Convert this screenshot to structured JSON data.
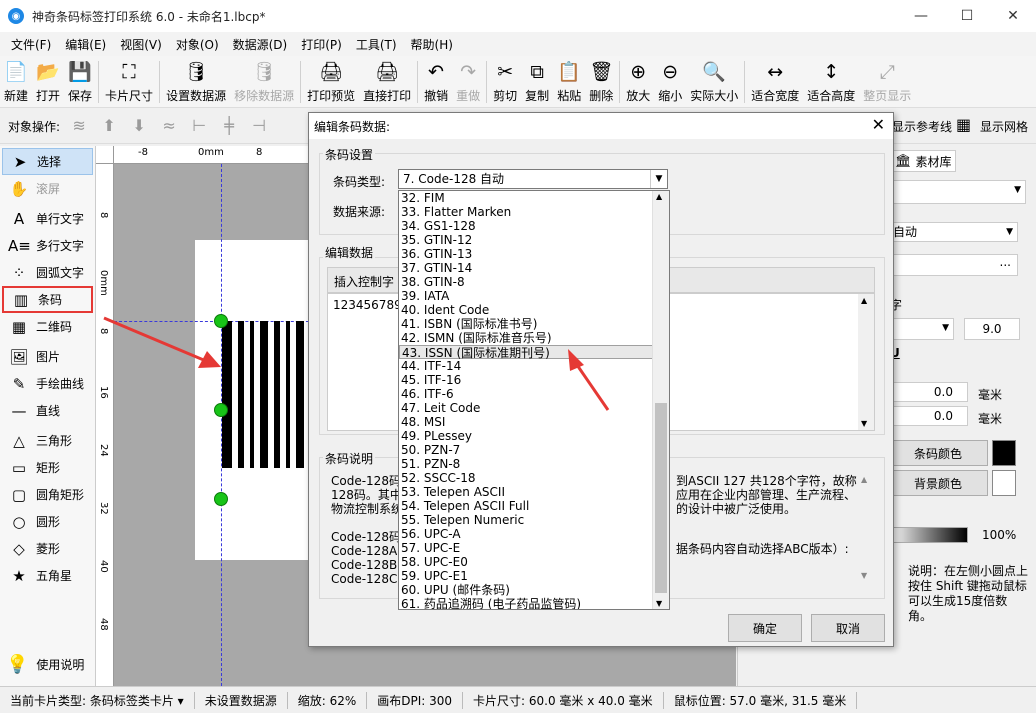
{
  "window": {
    "title": "神奇条码标签打印系统 6.0 - 未命名1.lbcp*",
    "min": "—",
    "max": "☐",
    "close": "✕"
  },
  "menu": [
    "文件(F)",
    "编辑(E)",
    "视图(V)",
    "对象(O)",
    "数据源(D)",
    "打印(P)",
    "工具(T)",
    "帮助(H)"
  ],
  "toolbar": [
    {
      "label": "新建",
      "icon": "📄",
      "icon_name": "new-file-icon",
      "enabled": true
    },
    {
      "label": "打开",
      "icon": "📂",
      "icon_name": "open-icon",
      "enabled": true
    },
    {
      "label": "保存",
      "icon": "💾",
      "icon_name": "save-icon",
      "enabled": true
    },
    {
      "label": "卡片尺寸",
      "icon": "⛶",
      "icon_name": "card-size-icon",
      "enabled": true
    },
    {
      "label": "设置数据源",
      "icon": "🛢",
      "icon_name": "database-icon",
      "enabled": true
    },
    {
      "label": "移除数据源",
      "icon": "🛢",
      "icon_name": "remove-database-icon",
      "enabled": false
    },
    {
      "label": "打印预览",
      "icon": "🖨",
      "icon_name": "print-preview-icon",
      "enabled": true
    },
    {
      "label": "直接打印",
      "icon": "🖨",
      "icon_name": "print-icon",
      "enabled": true
    },
    {
      "label": "撤销",
      "icon": "↶",
      "icon_name": "undo-icon",
      "enabled": true
    },
    {
      "label": "重做",
      "icon": "↷",
      "icon_name": "redo-icon",
      "enabled": false
    },
    {
      "label": "剪切",
      "icon": "✂",
      "icon_name": "cut-icon",
      "enabled": true
    },
    {
      "label": "复制",
      "icon": "⧉",
      "icon_name": "copy-icon",
      "enabled": true
    },
    {
      "label": "粘贴",
      "icon": "📋",
      "icon_name": "paste-icon",
      "enabled": true
    },
    {
      "label": "删除",
      "icon": "🗑",
      "icon_name": "delete-icon",
      "enabled": true
    },
    {
      "label": "放大",
      "icon": "⊕",
      "icon_name": "zoom-in-icon",
      "enabled": true
    },
    {
      "label": "缩小",
      "icon": "⊖",
      "icon_name": "zoom-out-icon",
      "enabled": true
    },
    {
      "label": "实际大小",
      "icon": "🔍",
      "icon_name": "actual-size-icon",
      "enabled": true
    },
    {
      "label": "适合宽度",
      "icon": "↔",
      "icon_name": "fit-width-icon",
      "enabled": true
    },
    {
      "label": "适合高度",
      "icon": "↕",
      "icon_name": "fit-height-icon",
      "enabled": true
    },
    {
      "label": "整页显示",
      "icon": "⤢",
      "icon_name": "fit-page-icon",
      "enabled": false
    }
  ],
  "objbar": {
    "label": "对象操作:",
    "show_guides": "显示参考线",
    "show_grid": "显示网格"
  },
  "tools": [
    {
      "label": "选择",
      "icon": "➤",
      "name": "select"
    },
    {
      "label": "滚屏",
      "icon": "✋",
      "name": "pan"
    },
    {
      "label": "单行文字",
      "icon": "A",
      "name": "single-line-text"
    },
    {
      "label": "多行文字",
      "icon": "A≡",
      "name": "multi-line-text"
    },
    {
      "label": "圆弧文字",
      "icon": "⁘",
      "name": "arc-text"
    },
    {
      "label": "条码",
      "icon": "▥",
      "name": "barcode"
    },
    {
      "label": "二维码",
      "icon": "▦",
      "name": "qrcode"
    },
    {
      "label": "图片",
      "icon": "🖼",
      "name": "image"
    },
    {
      "label": "手绘曲线",
      "icon": "✎",
      "name": "freehand"
    },
    {
      "label": "直线",
      "icon": "—",
      "name": "line"
    },
    {
      "label": "三角形",
      "icon": "△",
      "name": "triangle"
    },
    {
      "label": "矩形",
      "icon": "▭",
      "name": "rectangle"
    },
    {
      "label": "圆角矩形",
      "icon": "▢",
      "name": "rounded-rect"
    },
    {
      "label": "圆形",
      "icon": "○",
      "name": "circle"
    },
    {
      "label": "菱形",
      "icon": "◇",
      "name": "diamond"
    },
    {
      "label": "五角星",
      "icon": "★",
      "name": "star"
    }
  ],
  "help": "使用说明",
  "ruler": {
    "top": [
      "-8",
      "0mm",
      "8"
    ],
    "left": [
      "8",
      "0mm",
      "8",
      "16",
      "24",
      "32",
      "40",
      "48"
    ]
  },
  "right": {
    "tab": "素材库",
    "barcode_type": "自动",
    "ellipsis": "...",
    "font_label": "字",
    "font_size": "9.0",
    "underline": "U",
    "val1": "0.0",
    "unit1": "毫米",
    "val2": "0.0",
    "unit2": "毫米",
    "barcode_color": "条码颜色",
    "bg_color": "背景颜色",
    "opacity": "100%",
    "note": "说明：在左侧小圆点上按住 Shift 键拖动鼠标可以生成15度倍数角。"
  },
  "dialog": {
    "title": "编辑条码数据:",
    "close": "✕",
    "group_barcode": "条码设置",
    "type_label": "条码类型:",
    "type_value": "7. Code-128 自动",
    "source_label": "数据来源:",
    "group_edit": "编辑数据",
    "insert_ctrl": "插入控制字",
    "data_value": "123456789",
    "group_desc": "条码说明",
    "desc_left": [
      "Code-128码",
      "128码。其中",
      "物流控制系统",
      "",
      "Code-128码",
      "Code-128A:",
      "Code-128B:",
      "Code-128C:"
    ],
    "desc_right": [
      "到ASCII 127 共128个字符，故称",
      "应用在企业内部管理、生产流程、",
      "的设计中被广泛使用。",
      "",
      "据条码内容自动选择ABC版本）:"
    ],
    "ok": "确定",
    "cancel": "取消",
    "options": [
      "32.  FIM",
      "33.  Flatter Marken",
      "34.  GS1-128",
      "35.  GTIN-12",
      "36.  GTIN-13",
      "37.  GTIN-14",
      "38.  GTIN-8",
      "39.  IATA",
      "40.  Ident Code",
      "41.  ISBN (国际标准书号)",
      "42.  ISMN (国际标准音乐号)",
      "43.  ISSN (国际标准期刊号)",
      "44.  ITF-14",
      "45.  ITF-16",
      "46.  ITF-6",
      "47.  Leit Code",
      "48.  MSI",
      "49.  PLessey",
      "50.  PZN-7",
      "51.  PZN-8",
      "52.  SSCC-18",
      "53.  Telepen ASCII",
      "54.  Telepen ASCII Full",
      "55.  Telepen Numeric",
      "56.  UPC-A",
      "57.  UPC-E",
      "58.  UPC-E0",
      "59.  UPC-E1",
      "60.  UPU (邮件条码)",
      "61.  药品追溯码 (电子药品监管码)"
    ],
    "hover_index": 11
  },
  "status": [
    "当前卡片类型: 条码标签类卡片 ▾",
    "未设置数据源",
    "缩放: 62%",
    "画布DPI: 300",
    "卡片尺寸: 60.0 毫米 x 40.0 毫米",
    "鼠标位置: 57.0 毫米, 31.5 毫米"
  ],
  "colors": {
    "accent": "#e53935",
    "selected": "#cfe3f7",
    "handle": "#18c418"
  }
}
